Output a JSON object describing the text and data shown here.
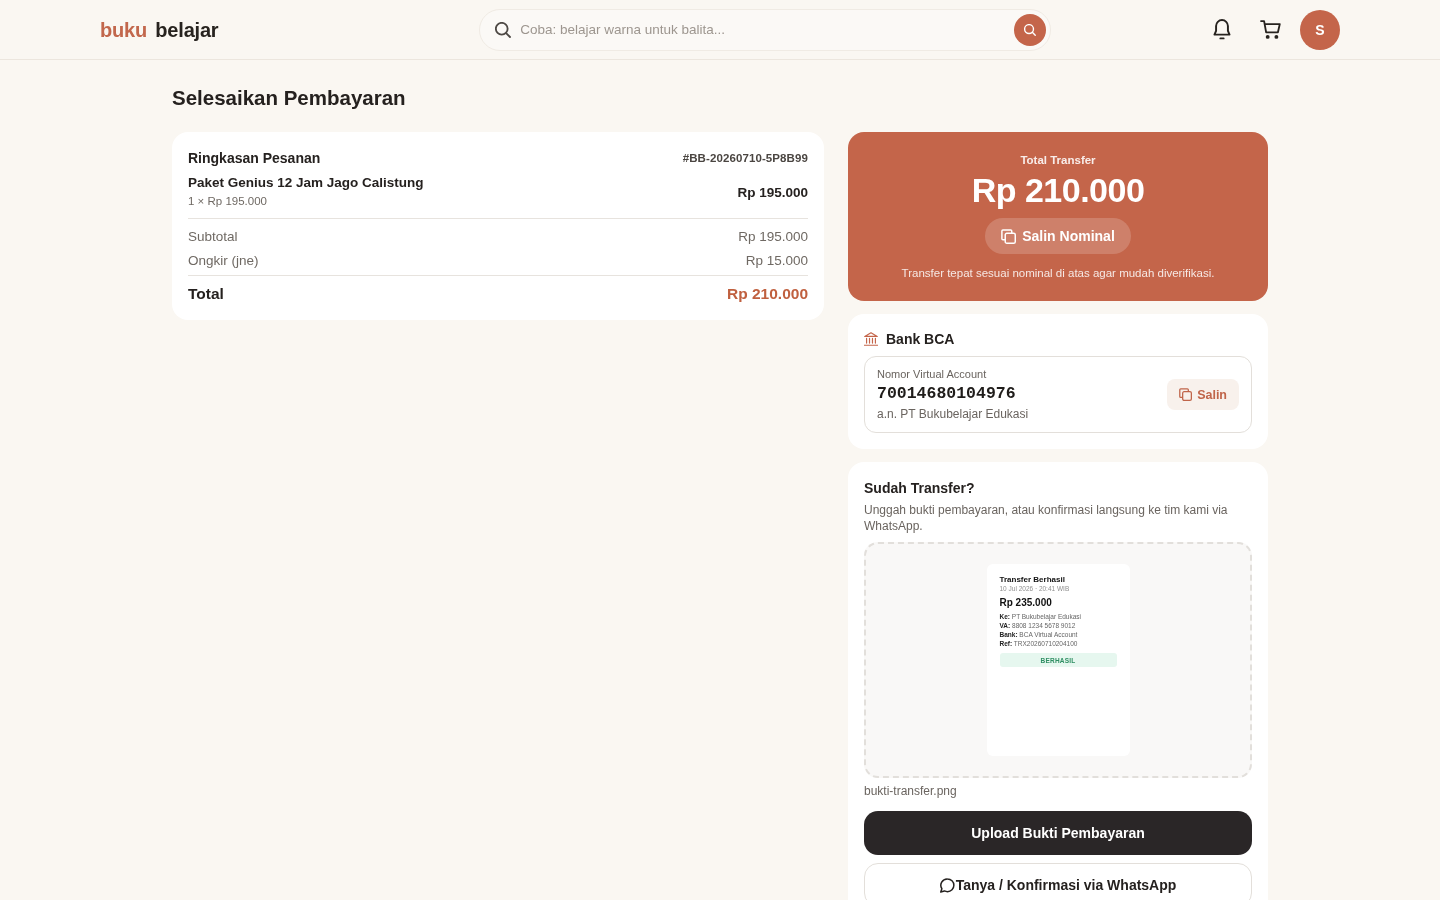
{
  "header": {
    "logo": {
      "accent": "buku",
      "text": "belajar"
    },
    "search": {
      "placeholder": "Coba: belajar warna untuk balita..."
    },
    "avatar": {
      "initial": "S"
    }
  },
  "page_title": "Selesaikan Pembayaran",
  "order_summary": {
    "title": "Ringkasan Pesanan",
    "order_id": "#BB-20260710-5P8B99",
    "items": [
      {
        "name": "Paket Genius 12 Jam Jago Calistung",
        "quantity_price": "1 × Rp 195.000",
        "price": "Rp 195.000"
      }
    ],
    "rows": [
      {
        "label": "Subtotal",
        "value": "Rp 195.000"
      },
      {
        "label": "Ongkir (jne)",
        "value": "Rp 15.000"
      }
    ],
    "total": {
      "label": "Total",
      "value": "Rp 210.000"
    }
  },
  "transfer": {
    "label": "Total Transfer",
    "amount": "Rp 210.000",
    "copy_button": "Salin Nominal",
    "note": "Transfer tepat sesuai nominal di atas agar mudah diverifikasi."
  },
  "bank": {
    "name": "Bank BCA",
    "account_label": "Nomor Virtual Account",
    "account_number": "70014680104976",
    "account_holder": "a.n. PT Bukubelajar Edukasi",
    "copy_button": "Salin"
  },
  "upload": {
    "title": "Sudah Transfer?",
    "description": "Unggah bukti pembayaran, atau konfirmasi langsung ke tim kami via WhatsApp.",
    "preview": {
      "title": "Transfer Berhasil",
      "date": "10 Jul 2026 · 20:41 WIB",
      "amount": "Rp 235.000",
      "details": [
        "**Ke:** PT Bukubelajar Edukasi",
        "**VA:** 8808 1234 5678 9012",
        "**Bank:** BCA Virtual Account",
        "**Ref:** TRX20260710204100"
      ],
      "status": "BERHASIL"
    },
    "file_name": "bukti-transfer.png",
    "upload_button": "Upload Bukti Pembayaran",
    "whatsapp_button": "Tanya / Konfirmasi via WhatsApp"
  }
}
